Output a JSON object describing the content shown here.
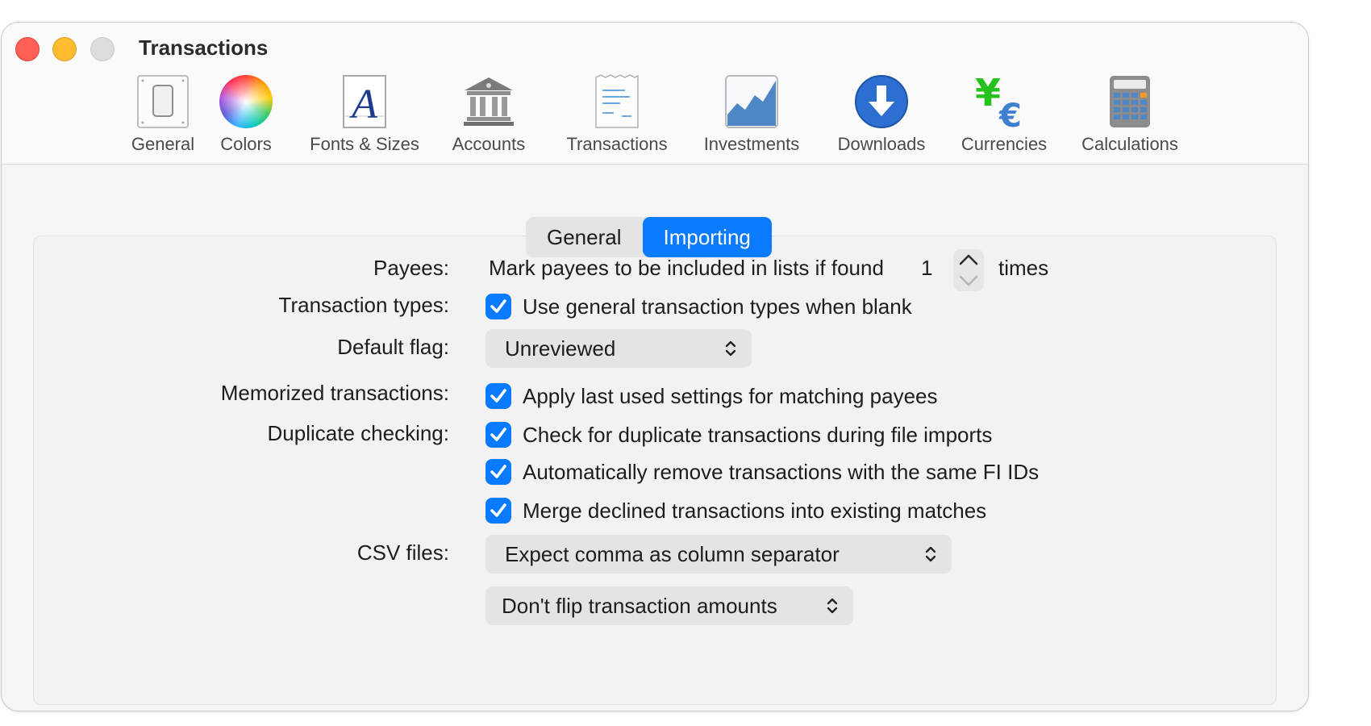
{
  "window": {
    "title": "Transactions"
  },
  "toolbar": {
    "items": [
      {
        "label": "General",
        "icon": "general-icon"
      },
      {
        "label": "Colors",
        "icon": "colors-icon"
      },
      {
        "label": "Fonts & Sizes",
        "icon": "fonts-icon"
      },
      {
        "label": "Accounts",
        "icon": "accounts-icon"
      },
      {
        "label": "Transactions",
        "icon": "transactions-icon"
      },
      {
        "label": "Investments",
        "icon": "investments-icon"
      },
      {
        "label": "Downloads",
        "icon": "downloads-icon"
      },
      {
        "label": "Currencies",
        "icon": "currencies-icon"
      },
      {
        "label": "Calculations",
        "icon": "calculations-icon"
      }
    ]
  },
  "tabs": {
    "general": "General",
    "importing": "Importing",
    "selected": "Importing"
  },
  "payees": {
    "label": "Payees:",
    "text": "Mark payees to be included in lists if found",
    "count": "1",
    "suffix": "times"
  },
  "transaction_types": {
    "label": "Transaction types:",
    "option": "Use general transaction types when blank",
    "checked": true
  },
  "default_flag": {
    "label": "Default flag:",
    "value": "Unreviewed"
  },
  "memorized": {
    "label": "Memorized transactions:",
    "option": "Apply last used settings for matching payees",
    "checked": true
  },
  "duplicates": {
    "label": "Duplicate checking:",
    "options": [
      {
        "text": "Check for duplicate transactions during file imports",
        "checked": true
      },
      {
        "text": "Automatically remove transactions with the same FI IDs",
        "checked": true
      },
      {
        "text": "Merge declined transactions into existing matches",
        "checked": true
      }
    ]
  },
  "csv": {
    "label": "CSV files:",
    "separator": "Expect comma as column separator",
    "flip": "Don't flip transaction amounts"
  },
  "colors": {
    "accent": "#0a7aff",
    "close": "#fe5f57",
    "minimize": "#febc2e",
    "zoom": "#dcdcdc"
  }
}
